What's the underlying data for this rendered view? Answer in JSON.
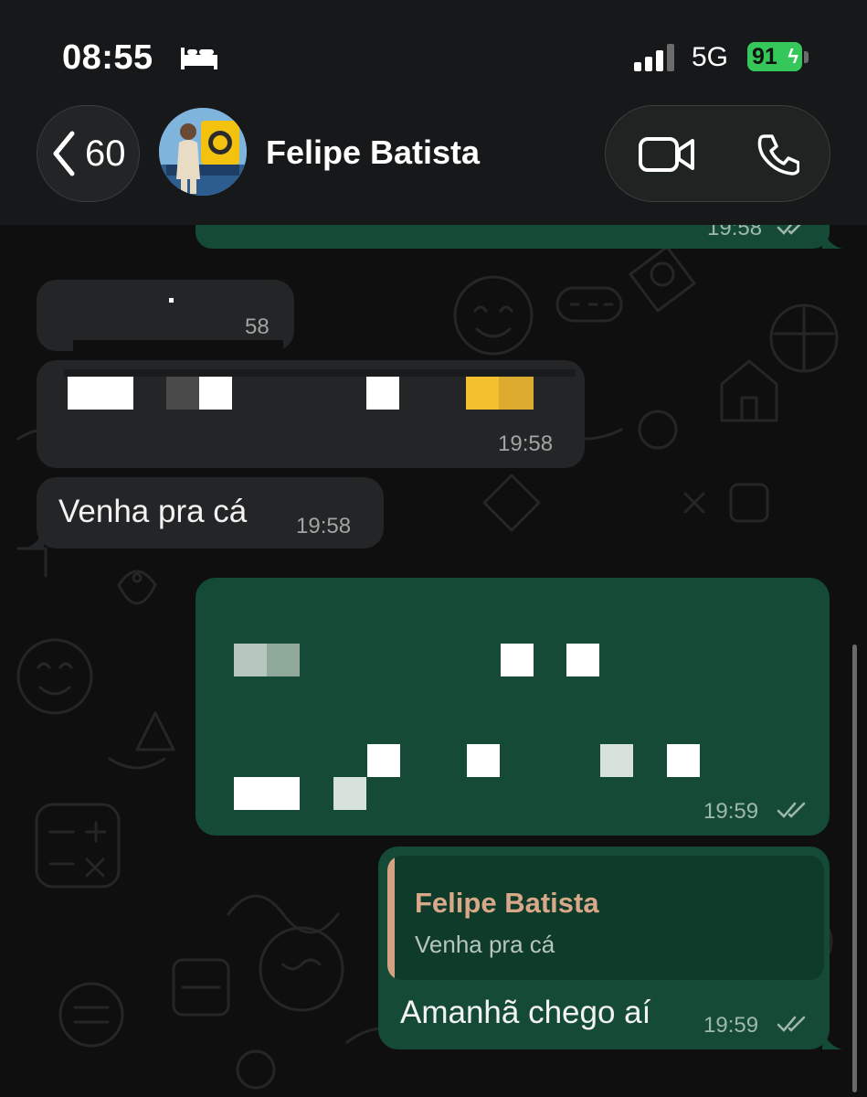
{
  "status_bar": {
    "time": "08:55",
    "network": "5G",
    "battery": "91"
  },
  "header": {
    "back_count": "60",
    "contact_name": "Felipe Batista"
  },
  "messages": {
    "top_out_time": "19:58",
    "m1_time_partial": "58",
    "m2_time": "19:58",
    "m3_text": "Venha pra cá",
    "m3_time": "19:58",
    "m4_time": "19:59",
    "m5_quote_name": "Felipe Batista",
    "m5_quote_text": "Venha pra cá",
    "m5_text": "Amanhã chego aí",
    "m5_time": "19:59"
  },
  "colors": {
    "outgoing_bubble": "#154b36",
    "incoming_bubble": "#232526",
    "battery": "#35c759",
    "quote_accent": "#d4a384"
  }
}
